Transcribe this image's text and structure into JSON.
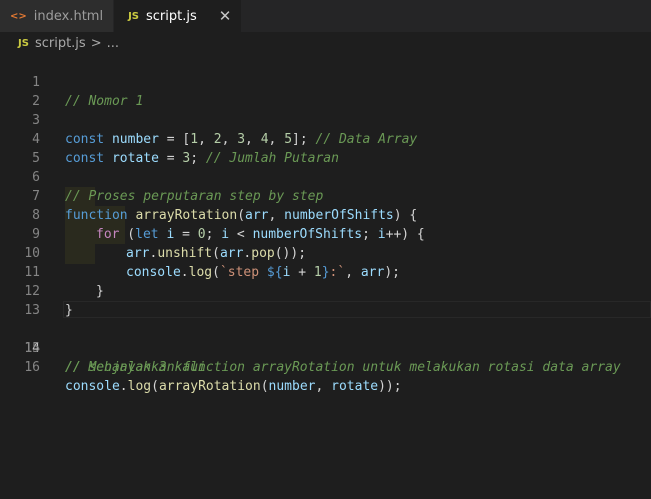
{
  "tabs": [
    {
      "icon": "html-icon",
      "icon_glyph": "<>",
      "label": "index.html",
      "active": false
    },
    {
      "icon": "js-icon",
      "icon_glyph": "JS",
      "label": "script.js",
      "active": true,
      "close": "✕"
    }
  ],
  "breadcrumb": {
    "icon_glyph": "JS",
    "file": "script.js",
    "separator": ">",
    "trail": "..."
  },
  "editor": {
    "current_line": 14,
    "lines": [
      {
        "num": "1"
      },
      {
        "num": "2"
      },
      {
        "num": "3"
      },
      {
        "num": "4"
      },
      {
        "num": "5"
      },
      {
        "num": "6"
      },
      {
        "num": "7"
      },
      {
        "num": "8"
      },
      {
        "num": "9"
      },
      {
        "num": "10"
      },
      {
        "num": "11"
      },
      {
        "num": "12"
      },
      {
        "num": "13"
      },
      {
        "num": "14"
      },
      {
        "num": "15"
      },
      {
        "num": "16"
      }
    ],
    "tokens": {
      "l1": "// Nomor 1",
      "l3_const": "const",
      "l3_var": "number",
      "l3_eq": " = [",
      "l3_n1": "1",
      "l3_n2": "2",
      "l3_n3": "3",
      "l3_n4": "4",
      "l3_n5": "5",
      "l3_comma": ", ",
      "l3_end": "];",
      "l3_comment": "// Data Array",
      "l4_const": "const",
      "l4_var": "rotate",
      "l4_eq": " = ",
      "l4_num": "3",
      "l4_semi": ";",
      "l4_comment": "// Jumlah Putaran",
      "l6": "// Proses perputaran step by step",
      "l7_kw": "function",
      "l7_fn": "arrayRotation",
      "l7_open": "(",
      "l7_p1": "arr",
      "l7_comma": ", ",
      "l7_p2": "numberOfShifts",
      "l7_close": ") {",
      "l8_for": "for",
      "l8_open": " (",
      "l8_let": "let",
      "l8_i": "i",
      "l8_eq": " = ",
      "l8_zero": "0",
      "l8_semi": "; ",
      "l8_i2": "i",
      "l8_lt": " < ",
      "l8_lim": "numberOfShifts",
      "l8_semi2": "; ",
      "l8_i3": "i",
      "l8_inc": "++) {",
      "l9_arr": "arr",
      "l9_dot": ".",
      "l9_fn": "unshift",
      "l9_open": "(",
      "l9_arr2": "arr",
      "l9_dot2": ".",
      "l9_fn2": "pop",
      "l9_close": "());",
      "l10_console": "console",
      "l10_dot": ".",
      "l10_fn": "log",
      "l10_open": "(",
      "l10_str1": "`step ",
      "l10_tpl_open": "${",
      "l10_i": "i",
      "l10_plus": " + ",
      "l10_one": "1",
      "l10_tpl_close": "}",
      "l10_str2": ":`",
      "l10_comma": ", ",
      "l10_arr": "arr",
      "l10_close": ");",
      "l11": "}",
      "l12": "}",
      "l14": "// Menjalankan function arrayRotation untuk melakukan rotasi data array",
      "l15": "// sebanyak 3 kali",
      "l16_console": "console",
      "l16_dot": ".",
      "l16_log": "log",
      "l16_open": "(",
      "l16_fn": "arrayRotation",
      "l16_open2": "(",
      "l16_a1": "number",
      "l16_comma": ", ",
      "l16_a2": "rotate",
      "l16_close": "));"
    }
  },
  "colors": {
    "background": "#1e1e1e",
    "tabbar": "#252526",
    "comment": "#6a9955",
    "keyword": "#569cd6",
    "control": "#c586c0",
    "variable": "#9cdcfe",
    "number": "#b5cea8",
    "function": "#dcdcaa",
    "string": "#ce9178"
  }
}
